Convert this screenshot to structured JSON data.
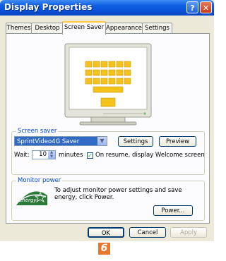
{
  "window": {
    "title": "Display Properties"
  },
  "titlebar": {
    "help_label": "?",
    "close_label": "✕"
  },
  "tabs": [
    {
      "label": "Themes",
      "active": false
    },
    {
      "label": "Desktop",
      "active": false
    },
    {
      "label": "Screen Saver",
      "active": true
    },
    {
      "label": "Appearance",
      "active": false
    },
    {
      "label": "Settings",
      "active": false
    }
  ],
  "screen_saver": {
    "group_label": "Screen saver",
    "selected": "SprintVideo4G Saver",
    "settings_label": "Settings",
    "preview_label": "Preview",
    "wait_label": "Wait:",
    "wait_value": "10",
    "minutes_label": "minutes",
    "resume_checked": true,
    "resume_label": "On resume, display Welcome screen"
  },
  "monitor_power": {
    "group_label": "Monitor power",
    "text": "To adjust monitor power settings and save energy, click Power.",
    "power_label": "Power..."
  },
  "footer": {
    "ok_label": "OK",
    "cancel_label": "Cancel",
    "apply_label": "Apply"
  },
  "badge": {
    "number": "6"
  },
  "colors": {
    "title_bar": "#0a4fd6",
    "dialog_bg": "#ece9d8",
    "selection": "#316ac5",
    "badge": "#e8762c",
    "key_yellow": "#f5c21b"
  }
}
